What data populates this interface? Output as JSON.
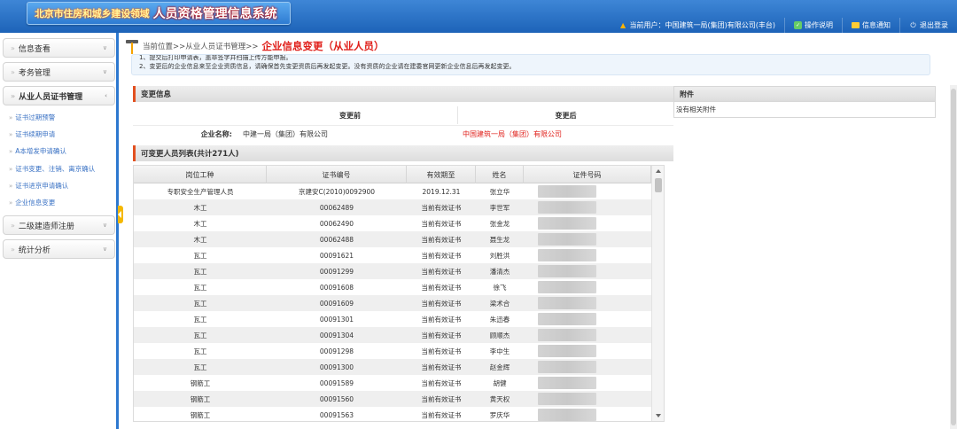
{
  "header": {
    "logo_small": "北京市住房和城乡建设领域",
    "logo_big": "人员资格管理信息系统",
    "current_user": "当前用户：中国建筑一局(集团)有限公司(丰台)",
    "help": "操作说明",
    "notify": "信息通知",
    "logout": "退出登录"
  },
  "sidebar": {
    "groups": [
      {
        "label": "信息查看"
      },
      {
        "label": "考务管理"
      },
      {
        "label": "从业人员证书管理"
      },
      {
        "label": "二级建造师注册"
      },
      {
        "label": "统计分析"
      }
    ],
    "sub_items": [
      {
        "label": "证书过期预警"
      },
      {
        "label": "证书续期申请"
      },
      {
        "label": "A本增发申请确认"
      },
      {
        "label": "证书变更、注销、离京确认"
      },
      {
        "label": "证书进京申请确认"
      },
      {
        "label": "企业信息变更"
      }
    ]
  },
  "breadcrumb": {
    "path": "当前位置>>从业人员证书管理>>",
    "title": "企业信息变更（从业人员）"
  },
  "notice": {
    "line1": "1、提交后打印申请表，盖章签字并扫描上传方能申报。",
    "line2": "2、变更后的企业信息来至企业资质信息，请确保首先变更资质后再发起变更。没有资质的企业请在建委官网更新企业信息后再发起变更。"
  },
  "change_info": {
    "section_title": "变更信息",
    "before_label": "变更前",
    "after_label": "变更后",
    "company_label": "企业名称:",
    "company_before": "中建一局（集团）有限公司",
    "company_after": "中国建筑一局（集团）有限公司"
  },
  "attachments": {
    "title": "附件",
    "empty": "没有相关附件"
  },
  "personnel": {
    "section_title": "可变更人员列表(共计271人)",
    "columns": [
      "岗位工种",
      "证书编号",
      "有效期至",
      "姓名",
      "证件号码"
    ],
    "rows": [
      {
        "job": "专职安全生产管理人员",
        "cert": "京建安C(2010)0092900",
        "valid": "2019.12.31",
        "name": "张立华"
      },
      {
        "job": "木工",
        "cert": "00062489",
        "valid": "当前有效证书",
        "name": "李世军"
      },
      {
        "job": "木工",
        "cert": "00062490",
        "valid": "当前有效证书",
        "name": "张金龙"
      },
      {
        "job": "木工",
        "cert": "00062488",
        "valid": "当前有效证书",
        "name": "聂生龙"
      },
      {
        "job": "瓦工",
        "cert": "00091621",
        "valid": "当前有效证书",
        "name": "刘胜洪"
      },
      {
        "job": "瓦工",
        "cert": "00091299",
        "valid": "当前有效证书",
        "name": "潘清杰"
      },
      {
        "job": "瓦工",
        "cert": "00091608",
        "valid": "当前有效证书",
        "name": "徐飞"
      },
      {
        "job": "瓦工",
        "cert": "00091609",
        "valid": "当前有效证书",
        "name": "梁术合"
      },
      {
        "job": "瓦工",
        "cert": "00091301",
        "valid": "当前有效证书",
        "name": "朱迅春"
      },
      {
        "job": "瓦工",
        "cert": "00091304",
        "valid": "当前有效证书",
        "name": "顾顺杰"
      },
      {
        "job": "瓦工",
        "cert": "00091298",
        "valid": "当前有效证书",
        "name": "李中生"
      },
      {
        "job": "瓦工",
        "cert": "00091300",
        "valid": "当前有效证书",
        "name": "赵金辉"
      },
      {
        "job": "钢筋工",
        "cert": "00091589",
        "valid": "当前有效证书",
        "name": "胡健"
      },
      {
        "job": "钢筋工",
        "cert": "00091560",
        "valid": "当前有效证书",
        "name": "黄天权"
      },
      {
        "job": "钢筋工",
        "cert": "00091563",
        "valid": "当前有效证书",
        "name": "罗庆华"
      }
    ]
  }
}
